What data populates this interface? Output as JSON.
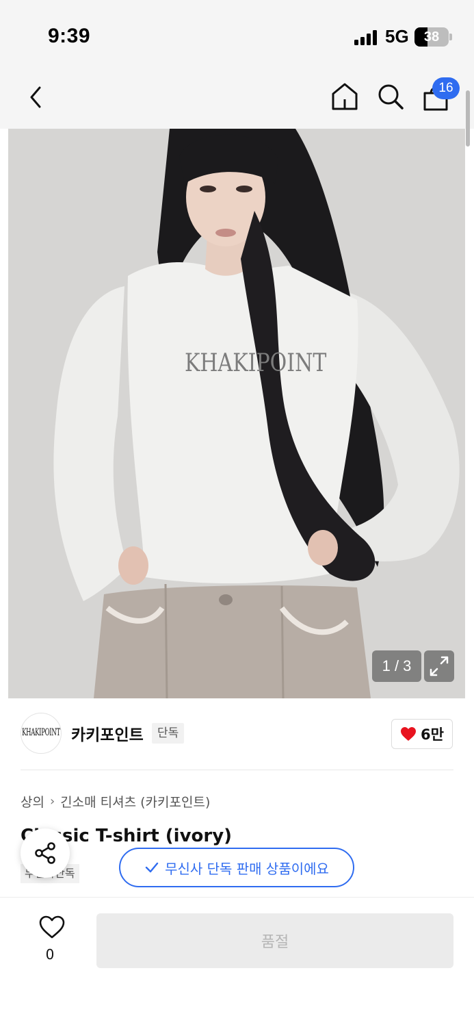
{
  "status_bar": {
    "time": "9:39",
    "network": "5G",
    "battery": "38",
    "battery_level": 0.38
  },
  "nav": {
    "back_icon": "chevron-left-icon",
    "home_icon": "home-icon",
    "search_icon": "search-icon",
    "cart_icon": "shopping-bag-icon",
    "cart_count": "16"
  },
  "gallery": {
    "counter": "1 / 3",
    "expand_icon": "expand-icon",
    "shirt_print": "KHAKIPOINT"
  },
  "brand": {
    "logo_text": "KHAKIPOINT",
    "name": "카키포인트",
    "badge": "단독",
    "likes": "6만"
  },
  "product": {
    "breadcrumb": [
      "상의",
      "긴소매 티셔츠 (카키포인트)"
    ],
    "title": "Classic T-shirt (ivory)",
    "tag": "무신사단독"
  },
  "share": {
    "icon": "share-icon"
  },
  "toast": {
    "text": "무신사 단독 판매 상품이에요"
  },
  "bottom_bar": {
    "wish_count": "0",
    "soldout_label": "품절"
  },
  "colors": {
    "accent": "#2f6cf0",
    "like_heart": "#e8131f",
    "soldout_bg": "#ebebeb",
    "soldout_text": "#b5b5b5"
  }
}
